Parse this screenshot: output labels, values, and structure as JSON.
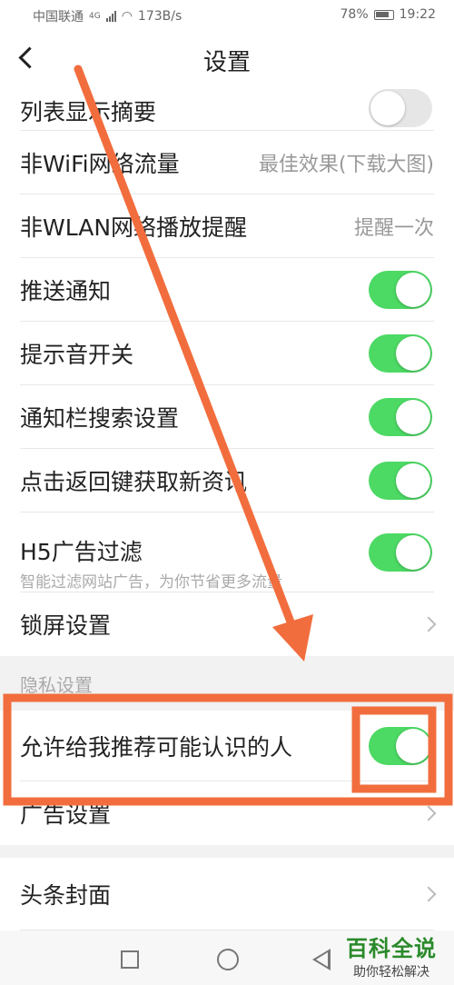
{
  "status": {
    "carrier": "中国联通",
    "network": "4G",
    "speed": "173B/s",
    "battery": "78%",
    "time": "19:22"
  },
  "header": {
    "title": "设置"
  },
  "settings": [
    {
      "label": "列表显示摘要",
      "toggle": "off"
    },
    {
      "label": "非WiFi网络流量",
      "value": "最佳效果(下载大图)"
    },
    {
      "label": "非WLAN网络播放提醒",
      "value": "提醒一次"
    },
    {
      "label": "推送通知",
      "toggle": "on"
    },
    {
      "label": "提示音开关",
      "toggle": "on"
    },
    {
      "label": "通知栏搜索设置",
      "toggle": "on"
    },
    {
      "label": "点击返回键获取新资讯",
      "toggle": "on"
    },
    {
      "label": "H5广告过滤",
      "sub": "智能过滤网站广告，为你节省更多流量",
      "toggle": "on"
    },
    {
      "label": "锁屏设置"
    }
  ],
  "privacy": {
    "header": "隐私设置",
    "items": [
      {
        "label": "允许给我推荐可能认识的人",
        "toggle": "on"
      },
      {
        "label": "广告设置"
      }
    ]
  },
  "more": [
    {
      "label": "头条封面"
    }
  ],
  "watermark": {
    "title": "百科全说",
    "subtitle": "助你轻松解决"
  },
  "colors": {
    "toggle_on": "#4cd964",
    "annotation": "#f26d3d",
    "watermark": "#2a8a2a"
  }
}
